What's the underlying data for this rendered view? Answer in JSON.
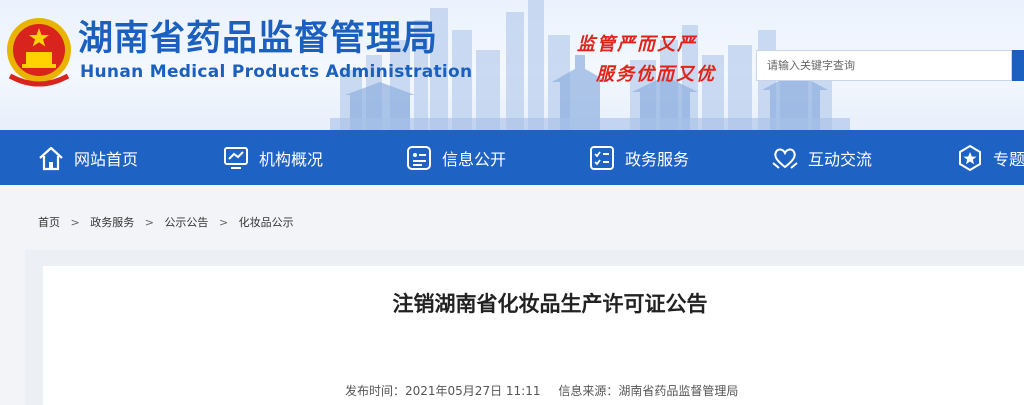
{
  "header": {
    "title_cn": "湖南省药品监督管理局",
    "title_en": "Hunan Medical Products Administration",
    "slogan_line1": "监管严而又严",
    "slogan_line2": "服务优而又优",
    "search_placeholder": "请输入关键字查询",
    "brand_color": "#1b5fbf",
    "slogan_color": "#e2231a"
  },
  "nav": {
    "background": "#1e63c4",
    "items": [
      {
        "label": "网站首页",
        "icon": "home-icon"
      },
      {
        "label": "机构概况",
        "icon": "monitor-chart-icon"
      },
      {
        "label": "信息公开",
        "icon": "info-card-icon"
      },
      {
        "label": "政务服务",
        "icon": "checklist-icon"
      },
      {
        "label": "互动交流",
        "icon": "heart-hands-icon"
      },
      {
        "label": "专题",
        "icon": "star-badge-icon"
      }
    ]
  },
  "breadcrumb": {
    "items": [
      "首页",
      "政务服务",
      "公示公告",
      "化妆品公示"
    ],
    "separator": ">"
  },
  "article": {
    "title": "注销湖南省化妆品生产许可证公告",
    "publish_label": "发布时间：2021年05月27日 11:11",
    "source_label": "信息来源：湖南省药品监督管理局"
  }
}
